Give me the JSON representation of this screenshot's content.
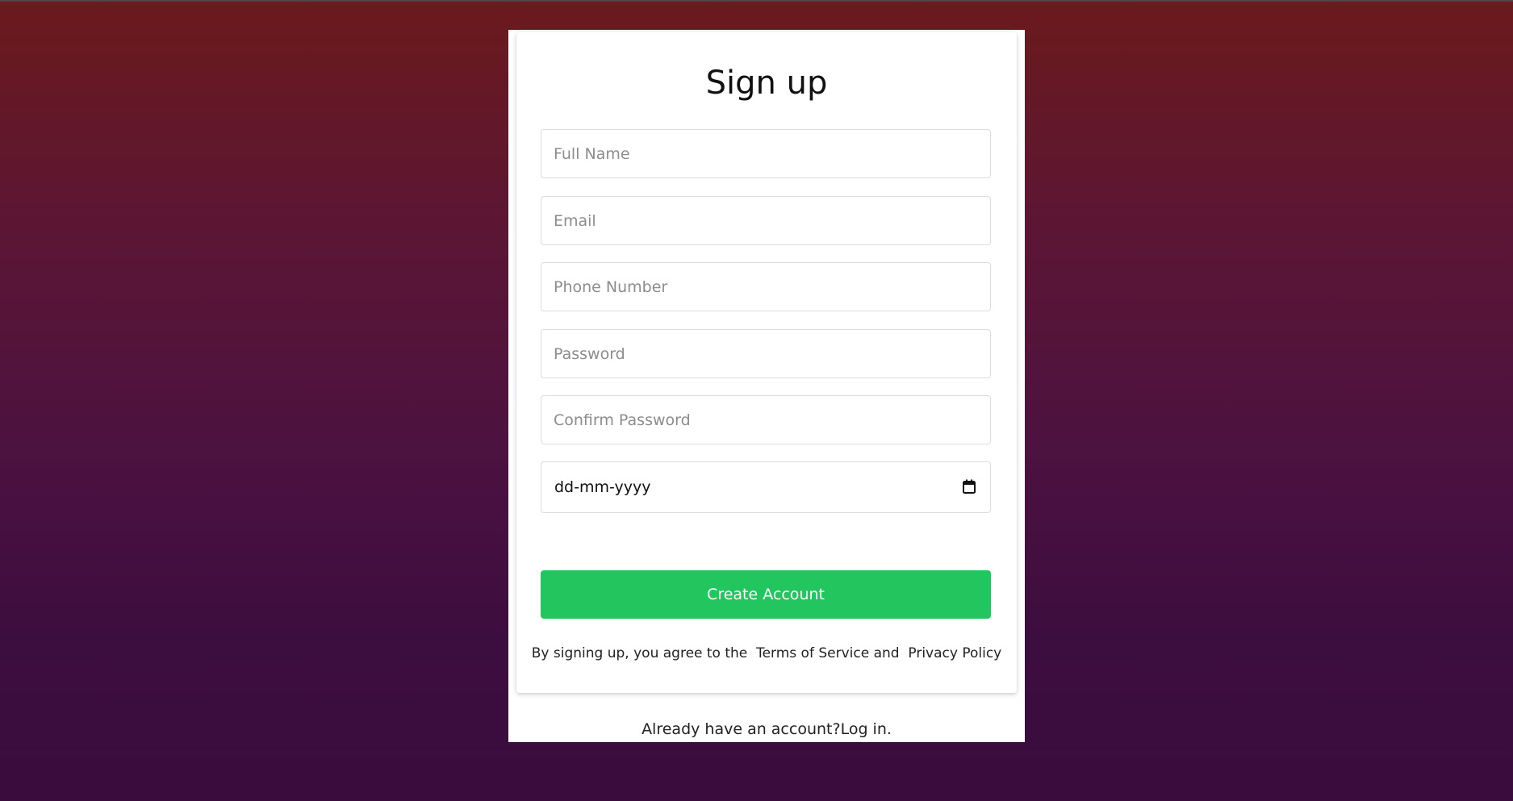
{
  "signup": {
    "title": "Sign up",
    "fields": {
      "full_name": {
        "placeholder": "Full Name",
        "value": ""
      },
      "email": {
        "placeholder": "Email",
        "value": ""
      },
      "phone": {
        "placeholder": "Phone Number",
        "value": ""
      },
      "password": {
        "placeholder": "Password",
        "value": ""
      },
      "confirm_password": {
        "placeholder": "Confirm Password",
        "value": ""
      },
      "birth_date": {
        "display": "dd-mm-yyyy",
        "icon": "calendar-icon"
      }
    },
    "create_button_label": "Create Account",
    "terms": {
      "prefix": "By signing up, you agree to the",
      "terms_link": "Terms of Service",
      "conjunction": "and",
      "privacy_link": "Privacy Policy"
    }
  },
  "footer": {
    "prompt": "Already have an account?",
    "login_link": "Log in."
  },
  "colors": {
    "accent_green": "#22c55e",
    "background_top": "#6b1a1c",
    "background_bottom": "#3a0c3d"
  }
}
